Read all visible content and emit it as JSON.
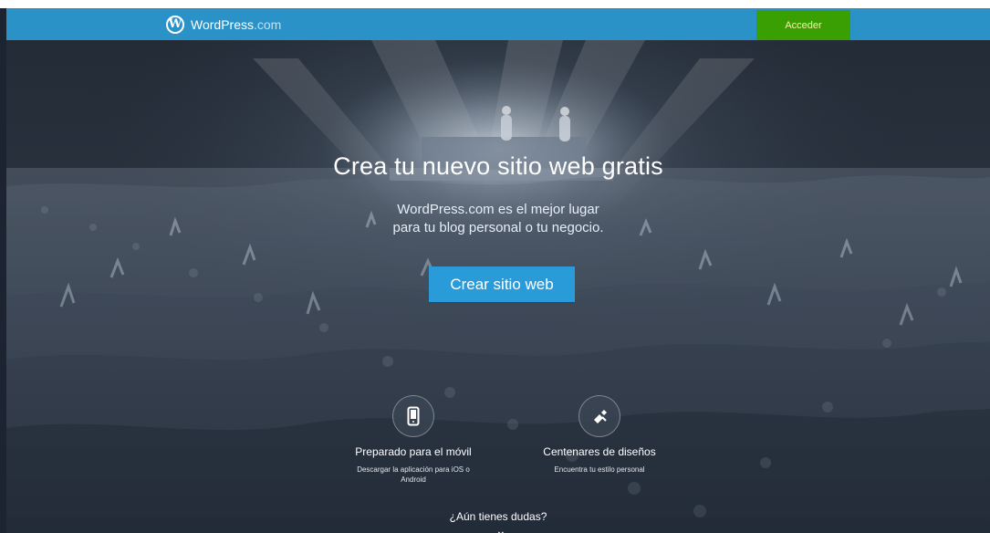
{
  "header": {
    "brand_main": "WordPress",
    "brand_suffix": ".com",
    "signin_label": "Acceder"
  },
  "hero": {
    "title": "Crea tu nuevo sitio web gratis",
    "subtitle_line1": "WordPress.com es el mejor lugar",
    "subtitle_line2": "para tu blog personal o tu negocio.",
    "cta_label": "Crear sitio web"
  },
  "features": [
    {
      "icon": "mobile-phone-icon",
      "title": "Preparado para el móvil",
      "text_line1": "Descargar la aplicación para iOS o",
      "text_line2": "Android"
    },
    {
      "icon": "paintbrush-icon",
      "title": "Centenares de diseños",
      "text_line1": "Encuentra tu estilo personal",
      "text_line2": ""
    }
  ],
  "footer": {
    "question": "¿Aún tienes dudas?",
    "chevron": "chevron-down-icon"
  },
  "colors": {
    "navbar": "#2b92c8",
    "signin": "#3aa000",
    "cta": "#2a9bd9"
  }
}
